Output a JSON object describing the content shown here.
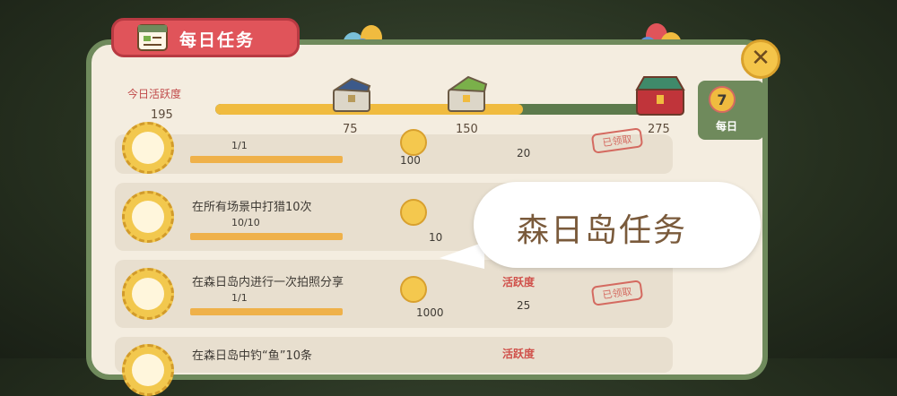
{
  "header": {
    "title": "每日任务"
  },
  "activity": {
    "label": "今日活跃度",
    "value": "195",
    "progress_fraction": 0.7,
    "max": 275
  },
  "milestones": [
    {
      "value": "75",
      "reward": "treasure-chest-icon"
    },
    {
      "value": "150",
      "reward": "treasure-chest-icon"
    },
    {
      "value": "275",
      "reward": "treasure-chest-icon"
    }
  ],
  "side_tab": {
    "label": "每日",
    "badge": "7"
  },
  "tasks": [
    {
      "title": "",
      "progress": "1/1",
      "coin_amount": "100",
      "activity_label": "",
      "activity_value": "20",
      "claimed_label": "已领取",
      "icon": "hat-icon"
    },
    {
      "title": "在所有场景中打猎10次",
      "progress": "10/10",
      "coin_amount": "10",
      "activity_label": "",
      "activity_value": "",
      "claimed_label": "",
      "icon": "slingshot-icon"
    },
    {
      "title": "在森日岛内进行一次拍照分享",
      "progress": "1/1",
      "coin_amount": "1000",
      "activity_label": "活跃度",
      "activity_value": "25",
      "claimed_label": "已领取",
      "icon": "camera-icon"
    },
    {
      "title": "在森日岛中钓“鱼”10条",
      "progress": "",
      "coin_amount": "",
      "activity_label": "活跃度",
      "activity_value": "",
      "claimed_label": "",
      "icon": "fish-icon"
    }
  ],
  "bubble": {
    "text": "森日岛任务"
  },
  "colors": {
    "accent_red": "#e0545a",
    "panel_green": "#6f8a5c",
    "progress_yellow": "#f0bb3f"
  }
}
